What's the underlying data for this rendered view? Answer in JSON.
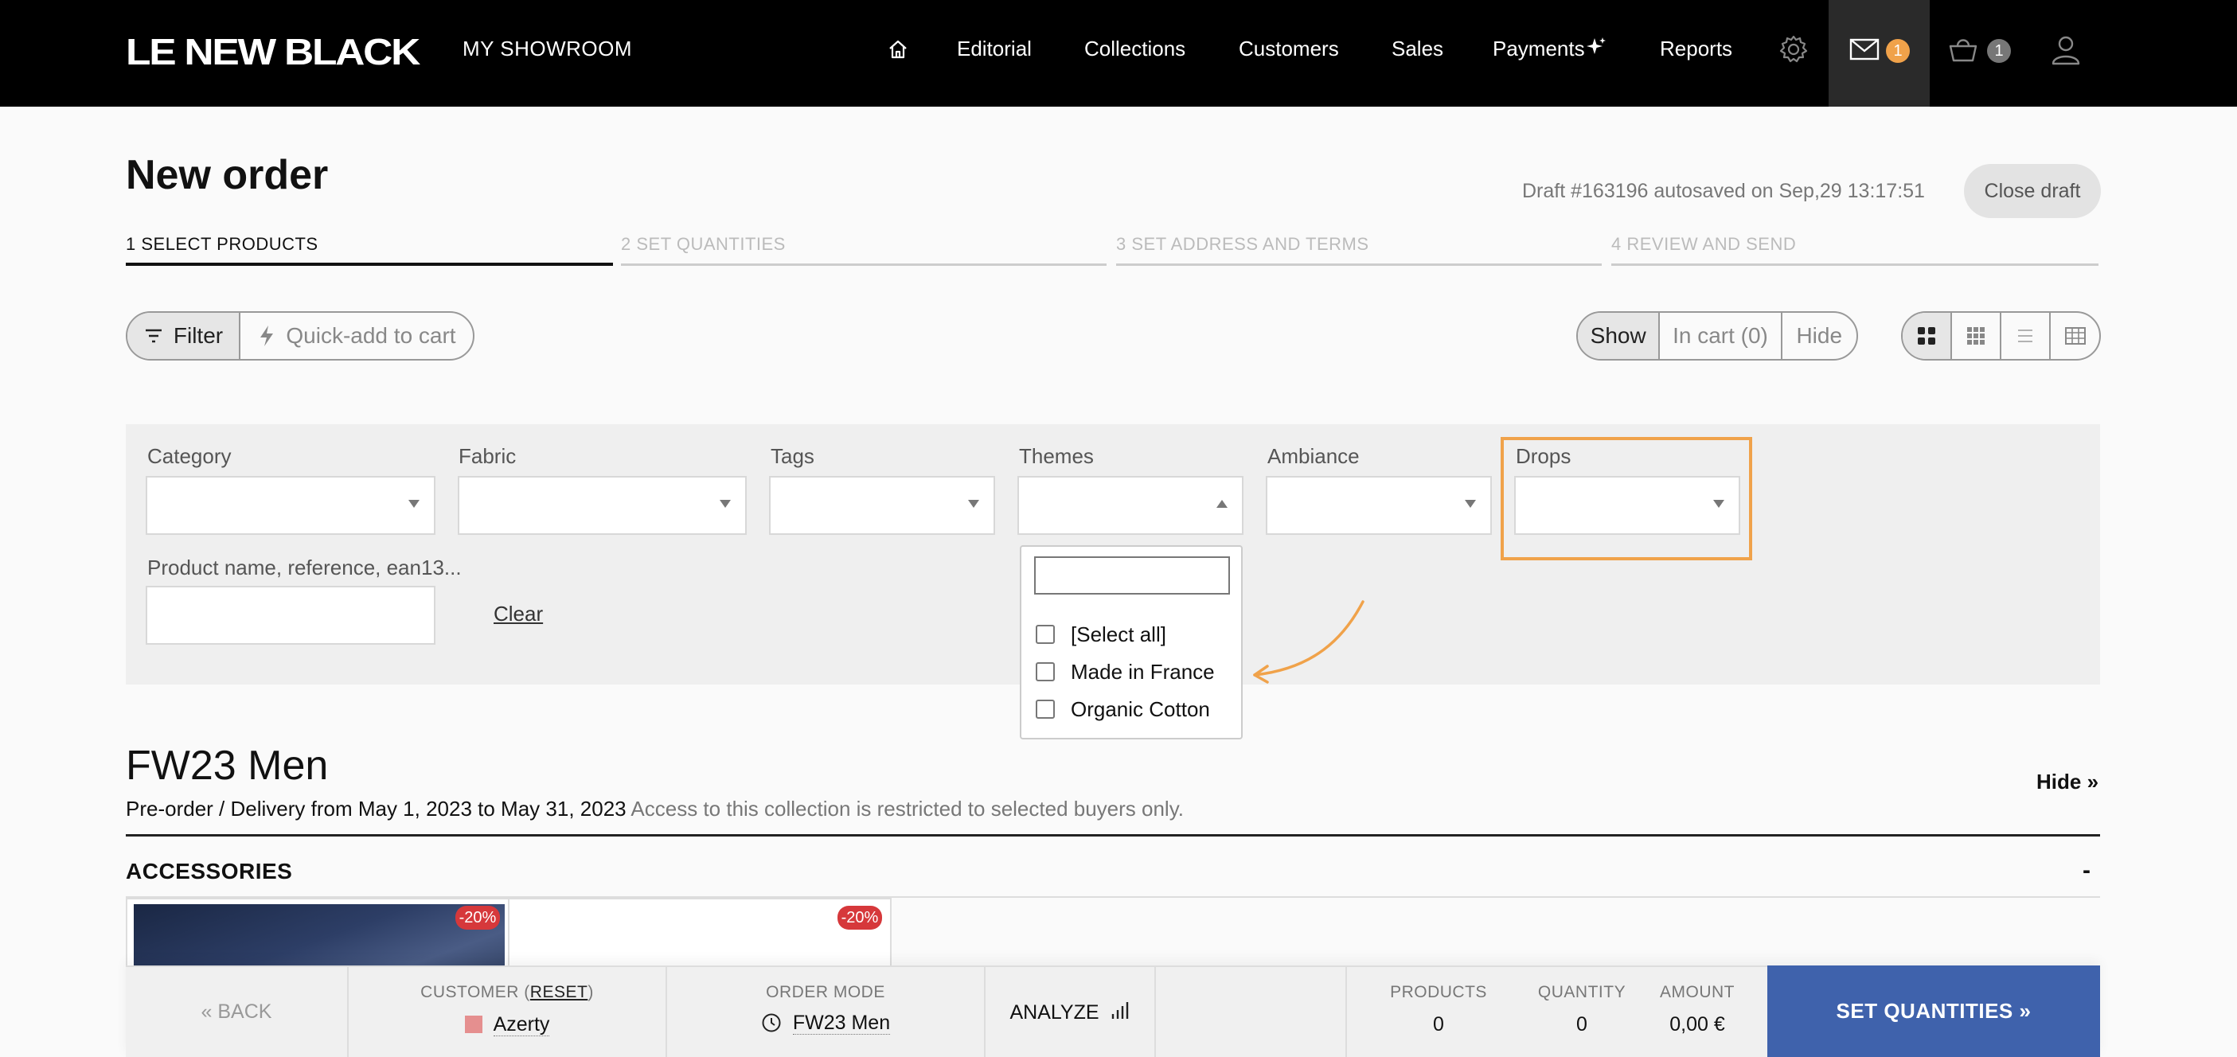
{
  "brand": {
    "logo_text": "LE NEW BLACK",
    "showroom": "MY SHOWROOM"
  },
  "nav": {
    "items": [
      "Editorial",
      "Collections",
      "Customers",
      "Sales",
      "Payments",
      "Reports"
    ],
    "mail_count": "1",
    "cart_count": "1"
  },
  "page": {
    "title": "New order",
    "draft_info": "Draft #163196 autosaved on Sep,29 13:17:51",
    "close_draft": "Close draft"
  },
  "steps": [
    "1 SELECT PRODUCTS",
    "2 SET QUANTITIES",
    "3 SET ADDRESS AND TERMS",
    "4 REVIEW AND SEND"
  ],
  "toolbar": {
    "filter": "Filter",
    "quick_add": "Quick-add to cart",
    "show": "Show",
    "in_cart": "In cart (0)",
    "hide": "Hide"
  },
  "filters": {
    "category": "Category",
    "fabric": "Fabric",
    "tags": "Tags",
    "themes": "Themes",
    "ambiance": "Ambiance",
    "drops": "Drops",
    "search_label": "Product name, reference, ean13...",
    "clear": "Clear"
  },
  "themes_dropdown": {
    "options": [
      "[Select all]",
      "Made in France",
      "Organic Cotton"
    ]
  },
  "collection": {
    "title": "FW23 Men",
    "delivery": "Pre-order / Delivery from May 1, 2023 to May 31, 2023",
    "restriction": "Access to this collection is restricted to selected buyers only.",
    "hide": "Hide »",
    "section": "ACCESSORIES",
    "section_toggle": "-"
  },
  "products": [
    {
      "discount": "-20%"
    },
    {
      "discount": "-20%"
    }
  ],
  "bottombar": {
    "back": "« BACK",
    "customer_label_pre": "CUSTOMER (",
    "customer_reset": "RESET",
    "customer_label_post": ")",
    "customer_name": "Azerty",
    "order_mode_label": "ORDER MODE",
    "order_mode_value": "FW23 Men",
    "analyze": "ANALYZE",
    "products_label": "PRODUCTS",
    "products_value": "0",
    "quantity_label": "QUANTITY",
    "quantity_value": "0",
    "amount_label": "AMOUNT",
    "amount_value": "0,00 €",
    "cta": "SET QUANTITIES »"
  },
  "colors": {
    "topbar": "#000000",
    "accent_orange": "#f0a24a",
    "cta_blue": "#3f62ac",
    "discount_red": "#d6383b"
  }
}
